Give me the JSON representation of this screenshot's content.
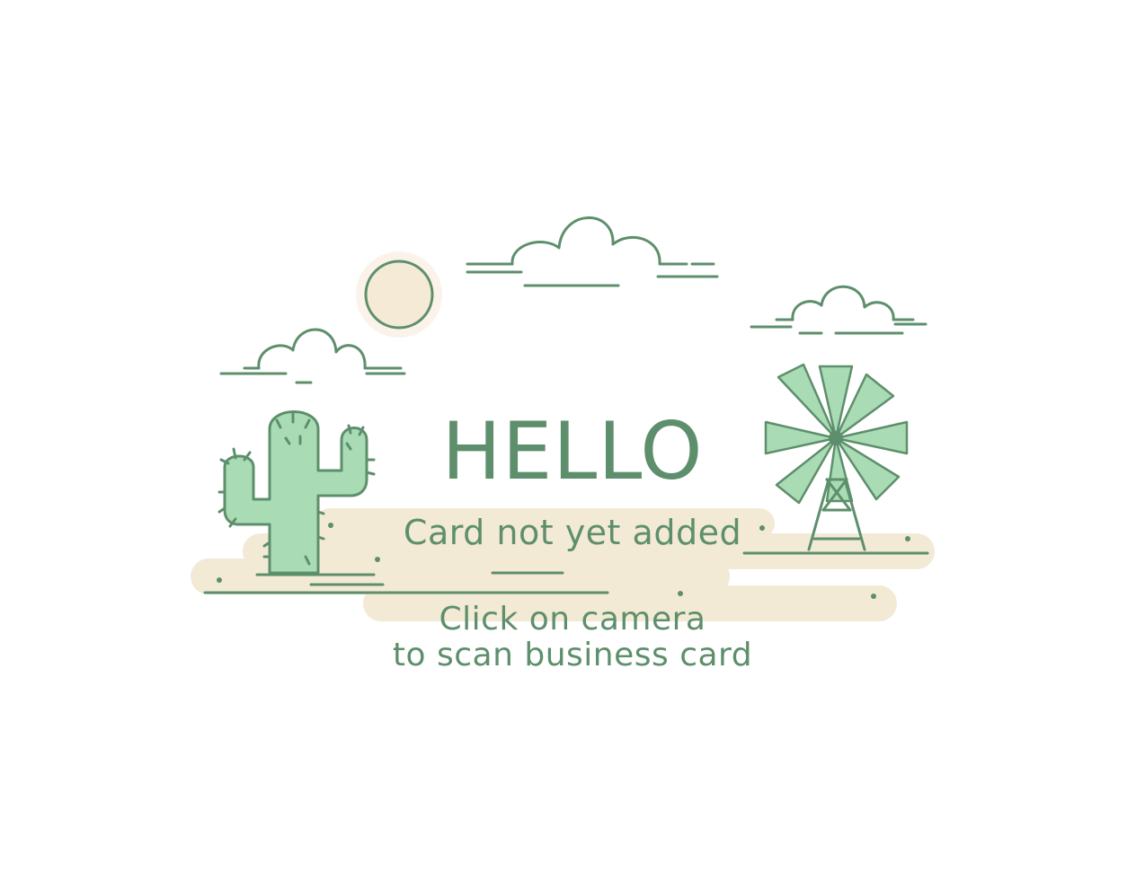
{
  "empty_state": {
    "heading": "HELLO",
    "status": "Card not yet added",
    "instruction_line1": "Click on camera",
    "instruction_line2": "to scan business card"
  },
  "illustration": {
    "icons": [
      "sun-icon",
      "cloud-icon",
      "cactus-icon",
      "windmill-icon",
      "ground-icon"
    ]
  },
  "colors": {
    "primary_green": "#5e8f6c",
    "light_green": "#a9dcb5",
    "sand": "#f3ead5",
    "sun_fill": "#f4ead6",
    "sun_glow": "#fbf3ea",
    "background": "#ffffff"
  }
}
